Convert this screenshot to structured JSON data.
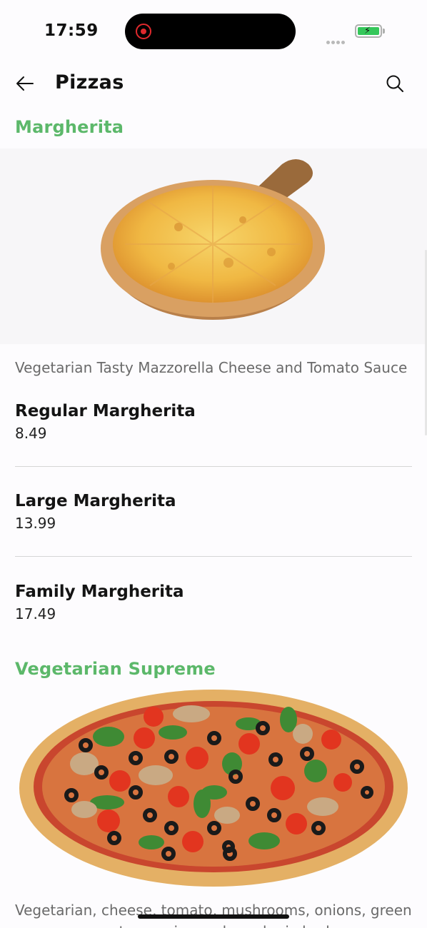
{
  "status_bar": {
    "time": "17:59"
  },
  "header": {
    "title": "Pizzas"
  },
  "sections": [
    {
      "title": "Margherita",
      "description": "Vegetarian Tasty Mazzorella Cheese and Tomato Sauce",
      "items": [
        {
          "name": "Regular Margherita",
          "price": "8.49"
        },
        {
          "name": "Large Margherita",
          "price": "13.99"
        },
        {
          "name": "Family Margherita",
          "price": "17.49"
        }
      ]
    },
    {
      "title": "Vegetarian Supreme",
      "description": "Vegetarian, cheese, tomato, mushrooms, onions, green peppers, sweetcorn, pineapple and mix herbs"
    }
  ],
  "colors": {
    "accent": "#5cb86a",
    "battery": "#35c75a",
    "recording": "#e0292d"
  },
  "icons": [
    "back-arrow-icon",
    "search-icon",
    "recording-icon",
    "battery-charging-icon",
    "signal-icon"
  ]
}
